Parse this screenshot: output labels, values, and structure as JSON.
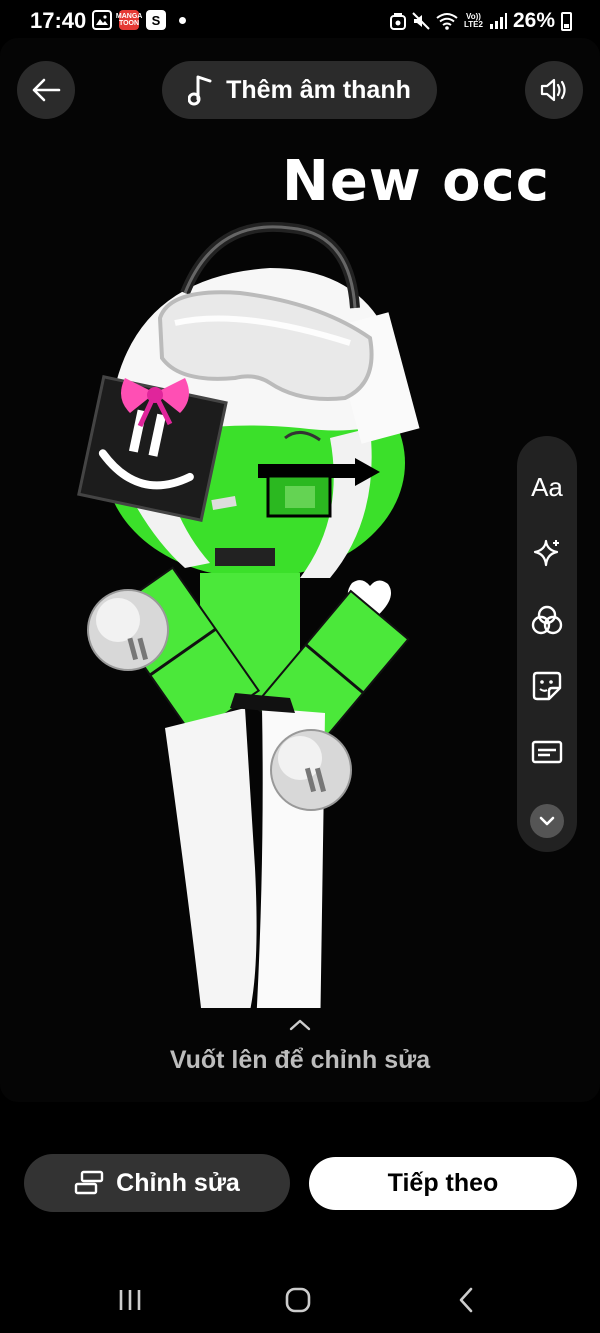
{
  "status_bar": {
    "time": "17:40",
    "notification_icons": [
      "gallery-icon",
      "manga-toon-icon",
      "shopee-icon"
    ],
    "manga_badge": "MANGA TOON",
    "shop_badge": "S",
    "network_label_top": "Vo))",
    "network_label_bottom": "LTE2",
    "battery": "26%"
  },
  "header": {
    "add_audio_label": "Thêm âm thanh"
  },
  "canvas": {
    "overlay_text": "New occ",
    "swipe_hint": "Vuốt lên để chỉnh sửa",
    "colors": {
      "character_green": "#3be02a",
      "background": "#050505"
    }
  },
  "tools": {
    "text_tool_label": "Aa",
    "items": [
      "text-tool",
      "effects-icon",
      "filters-icon",
      "sticker-icon",
      "captions-icon",
      "expand-more-icon"
    ]
  },
  "actions": {
    "edit_label": "Chỉnh sửa",
    "next_label": "Tiếp theo"
  },
  "navigation": [
    "recent-apps-icon",
    "home-icon",
    "back-nav-icon"
  ]
}
